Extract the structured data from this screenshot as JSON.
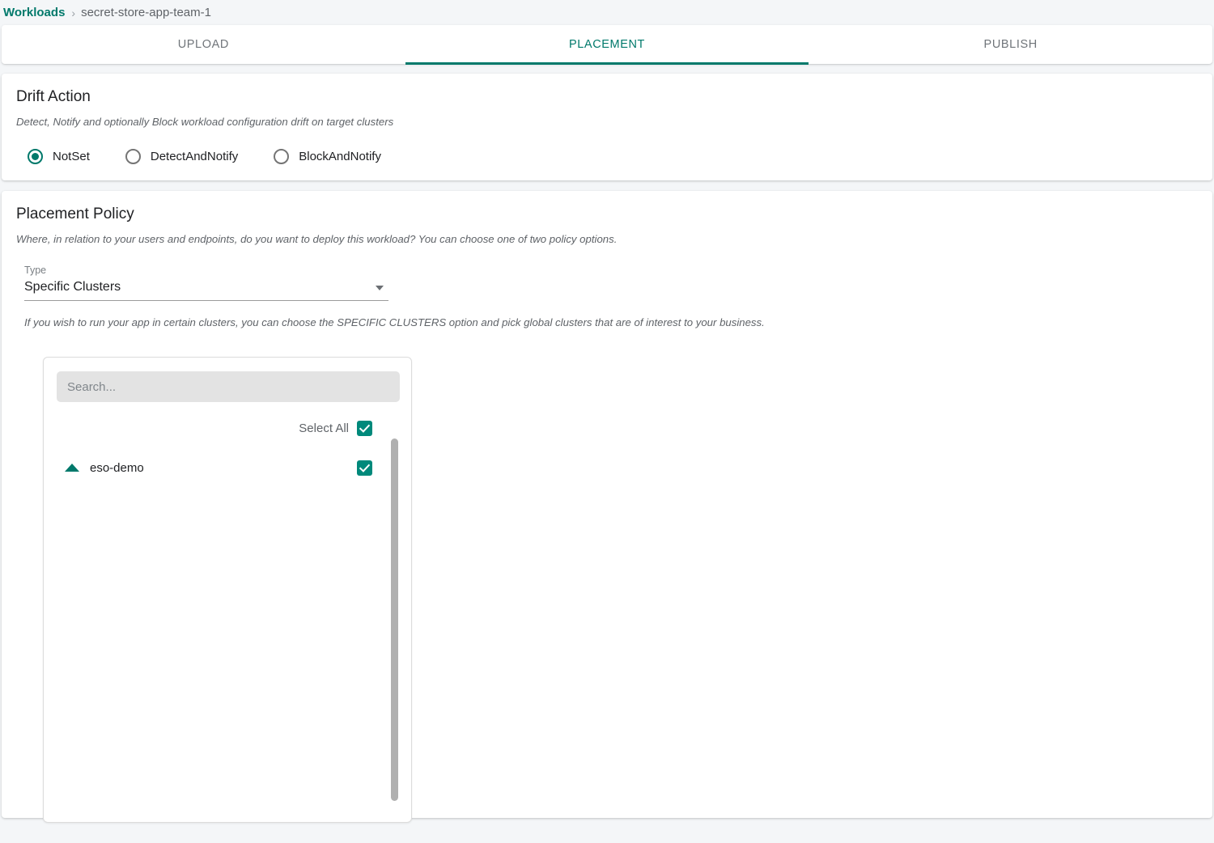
{
  "breadcrumb": {
    "root_label": "Workloads",
    "separator": "›",
    "current_label": "secret-store-app-team-1"
  },
  "tabs": [
    {
      "label": "UPLOAD",
      "active": false
    },
    {
      "label": "PLACEMENT",
      "active": true
    },
    {
      "label": "PUBLISH",
      "active": false
    }
  ],
  "drift_action": {
    "title": "Drift Action",
    "description": "Detect, Notify and optionally Block workload configuration drift on target clusters",
    "options": [
      {
        "label": "NotSet",
        "selected": true
      },
      {
        "label": "DetectAndNotify",
        "selected": false
      },
      {
        "label": "BlockAndNotify",
        "selected": false
      }
    ]
  },
  "placement_policy": {
    "title": "Placement Policy",
    "description": "Where, in relation to your users and endpoints, do you want to deploy this workload? You can choose one of two policy options.",
    "type_field": {
      "label": "Type",
      "value": "Specific Clusters"
    },
    "hint": "If you wish to run your app in certain clusters, you can choose the SPECIFIC CLUSTERS option and pick global clusters that are of interest to your business.",
    "cluster_picker": {
      "search_placeholder": "Search...",
      "search_value": "",
      "select_all_label": "Select All",
      "select_all_checked": true,
      "clusters": [
        {
          "name": "eso-demo",
          "checked": true,
          "expanded": true
        }
      ]
    }
  },
  "colors": {
    "accent": "#00796b",
    "checkbox": "#00897b",
    "page_bg": "#f4f6f8",
    "muted_text": "#5f6368"
  }
}
